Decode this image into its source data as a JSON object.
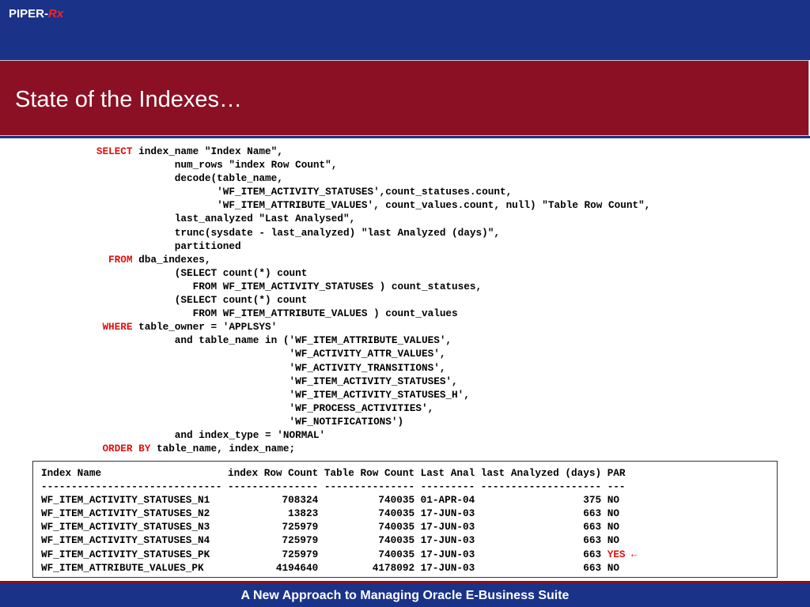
{
  "header": {
    "brand_main": "PIPER-",
    "brand_rx": "Rx",
    "title": "State of the Indexes…"
  },
  "sql": {
    "lines": [
      {
        "kw": "SELECT",
        "rest": " index_name \"Index Name\","
      },
      {
        "kw": "",
        "rest": "       num_rows \"index Row Count\","
      },
      {
        "kw": "",
        "rest": "       decode(table_name,"
      },
      {
        "kw": "",
        "rest": "              'WF_ITEM_ACTIVITY_STATUSES',count_statuses.count,"
      },
      {
        "kw": "",
        "rest": "              'WF_ITEM_ATTRIBUTE_VALUES', count_values.count, null) \"Table Row Count\","
      },
      {
        "kw": "",
        "rest": "       last_analyzed \"Last Analysed\","
      },
      {
        "kw": "",
        "rest": "       trunc(sysdate - last_analyzed) \"last Analyzed (days)\","
      },
      {
        "kw": "",
        "rest": "       partitioned"
      },
      {
        "kw": "  FROM",
        "rest": " dba_indexes,"
      },
      {
        "kw": "",
        "rest": "       (SELECT count(*) count"
      },
      {
        "kw": "",
        "rest": "          FROM WF_ITEM_ACTIVITY_STATUSES ) count_statuses,"
      },
      {
        "kw": "",
        "rest": "       (SELECT count(*) count"
      },
      {
        "kw": "",
        "rest": "          FROM WF_ITEM_ATTRIBUTE_VALUES ) count_values"
      },
      {
        "kw": " WHERE",
        "rest": " table_owner = 'APPLSYS'"
      },
      {
        "kw": "",
        "rest": "       and table_name in ('WF_ITEM_ATTRIBUTE_VALUES',"
      },
      {
        "kw": "",
        "rest": "                          'WF_ACTIVITY_ATTR_VALUES',"
      },
      {
        "kw": "",
        "rest": "                          'WF_ACTIVITY_TRANSITIONS',"
      },
      {
        "kw": "",
        "rest": "                          'WF_ITEM_ACTIVITY_STATUSES',"
      },
      {
        "kw": "",
        "rest": "                          'WF_ITEM_ACTIVITY_STATUSES_H',"
      },
      {
        "kw": "",
        "rest": "                          'WF_PROCESS_ACTIVITIES',"
      },
      {
        "kw": "",
        "rest": "                          'WF_NOTIFICATIONS')"
      },
      {
        "kw": "",
        "rest": "       and index_type = 'NORMAL'"
      },
      {
        "kw": " ORDER BY",
        "rest": " table_name, index_name;"
      }
    ]
  },
  "results": {
    "header": "Index Name                     index Row Count Table Row Count Last Anal last Analyzed (days) PAR",
    "underline": "------------------------------ --------------- --------------- --------- -------------------- ---",
    "rows": [
      {
        "text": "WF_ITEM_ACTIVITY_STATUSES_N1            708324          740035 01-APR-04                  375 ",
        "par": "NO",
        "flag": false
      },
      {
        "text": "WF_ITEM_ACTIVITY_STATUSES_N2             13823          740035 17-JUN-03                  663 ",
        "par": "NO",
        "flag": false
      },
      {
        "text": "WF_ITEM_ACTIVITY_STATUSES_N3            725979          740035 17-JUN-03                  663 ",
        "par": "NO",
        "flag": false
      },
      {
        "text": "WF_ITEM_ACTIVITY_STATUSES_N4            725979          740035 17-JUN-03                  663 ",
        "par": "NO",
        "flag": false
      },
      {
        "text": "WF_ITEM_ACTIVITY_STATUSES_PK            725979          740035 17-JUN-03                  663 ",
        "par": "YES",
        "flag": true
      },
      {
        "text": "WF_ITEM_ATTRIBUTE_VALUES_PK            4194640         4178092 17-JUN-03                  663 ",
        "par": "NO",
        "flag": false
      }
    ],
    "arrow_icon": "arrow-left-icon"
  },
  "footer": {
    "text": "A New Approach to Managing Oracle E-Business Suite"
  },
  "colors": {
    "blue": "#1a3288",
    "maroon": "#8b1023",
    "keyword_red": "#e01010"
  }
}
